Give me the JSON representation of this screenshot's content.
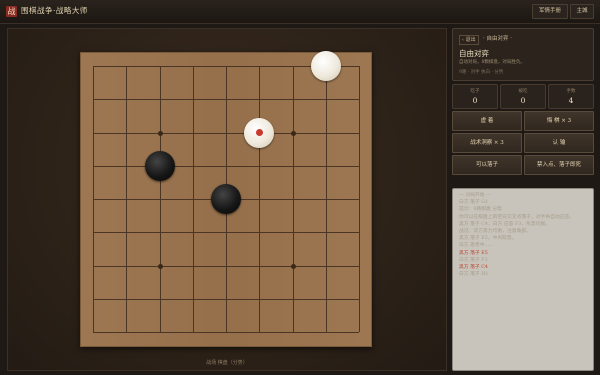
{
  "app": {
    "logo_char": "战",
    "title": "围棋战争·战略大师",
    "top_buttons": {
      "manual": "军情手册",
      "home": "主城"
    }
  },
  "board": {
    "size": 9,
    "hoshi": [
      [
        2,
        2
      ],
      [
        6,
        2
      ],
      [
        2,
        6
      ],
      [
        6,
        6
      ]
    ],
    "stones": [
      {
        "color": "white",
        "col": 7,
        "row": 0,
        "last": false
      },
      {
        "color": "white",
        "col": 5,
        "row": 2,
        "last": true
      },
      {
        "color": "black",
        "col": 2,
        "row": 3,
        "last": false
      },
      {
        "color": "black",
        "col": 4,
        "row": 4,
        "last": false
      }
    ],
    "caption": "战场 棋盘（分势）"
  },
  "mode": {
    "back": "‹ 退出",
    "crumb": "· 自由对弈 ·",
    "title": "自由对弈",
    "desc": "自动对局，8颗棋盘，对局胜负。",
    "meta": "9路 · 对手 执白 · 分势"
  },
  "stats": [
    {
      "label": "吃子",
      "value": "0"
    },
    {
      "label": "被吃",
      "value": "0"
    },
    {
      "label": "手数",
      "value": "4"
    }
  ],
  "actions": {
    "pass": "虚 着",
    "undo": "悔 棋 × 3",
    "tactic": "战术洞察 × 3",
    "resign": "认 输",
    "place": "可以落子",
    "forbidden": "禁入点、落子即死"
  },
  "log": [
    {
      "text": "— 对局开始 —",
      "hl": false
    },
    {
      "text": "白方 落子 G1",
      "hl": false
    },
    {
      "text": "提示：9路棋盘 分势",
      "hl": false
    },
    {
      "text": "你可以在棋盘上的空白交叉点落子，对手将自动应答。",
      "hl": false
    },
    {
      "text": "黑方 落子 C4，白方 应答 F3，形势均衡。",
      "hl": false
    },
    {
      "text": "战况：双方势力均衡，注意角部。",
      "hl": false
    },
    {
      "text": "黑方 落子 E5，中央取势。",
      "hl": false
    },
    {
      "text": "白方 思考中……",
      "hl": false
    },
    {
      "text": "黑方 落子 E5",
      "hl": true
    },
    {
      "text": "白方 落子 F3",
      "hl": false
    },
    {
      "text": "黑方 落子 C4",
      "hl": true
    },
    {
      "text": "白方 落子 H1",
      "hl": false
    }
  ]
}
